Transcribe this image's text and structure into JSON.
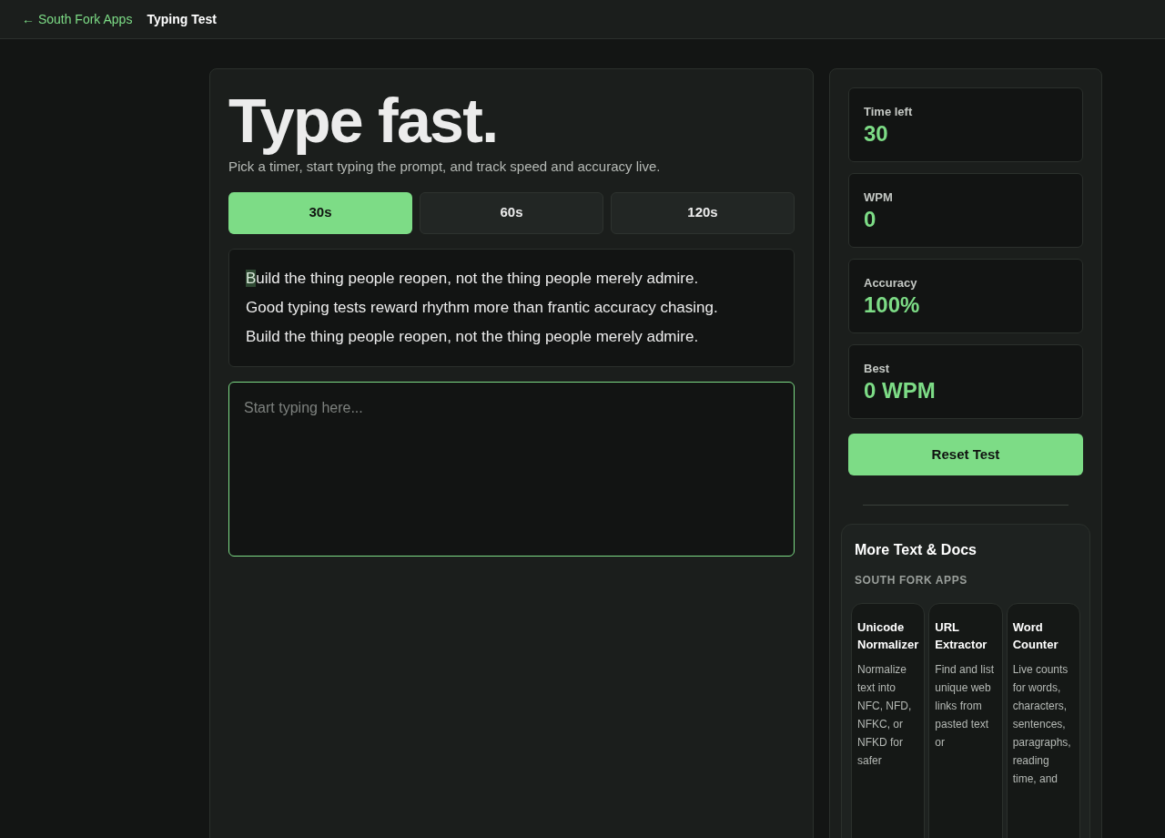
{
  "nav": {
    "back_link": "← South Fork Apps",
    "title": "Typing Test"
  },
  "hero": {
    "heading": "Type fast.",
    "subtitle": "Pick a timer, start typing the prompt, and track speed and accuracy live."
  },
  "timers": [
    {
      "label": "30s",
      "selected": true
    },
    {
      "label": "60s",
      "selected": false
    },
    {
      "label": "120s",
      "selected": false
    }
  ],
  "prompt": {
    "current_char": "B",
    "lines": [
      "uild the thing people reopen, not the thing people merely admire.",
      "Good typing tests reward rhythm more than frantic accuracy chasing.",
      "Build the thing people reopen, not the thing people merely admire."
    ]
  },
  "input": {
    "placeholder": "Start typing here..."
  },
  "stats": [
    {
      "label": "Time left",
      "value": "30"
    },
    {
      "label": "WPM",
      "value": "0"
    },
    {
      "label": "Accuracy",
      "value": "100%"
    },
    {
      "label": "Best",
      "value": "0 WPM"
    }
  ],
  "reset_button": "Reset Test",
  "related": {
    "title": "More Text & Docs",
    "subtitle": "SOUTH FORK APPS",
    "apps": [
      {
        "name": "Unicode Normalizer",
        "description": "Normalize text into NFC, NFD, NFKC, or NFKD for safer"
      },
      {
        "name": "URL Extractor",
        "description": "Find and list unique web links from pasted text or"
      },
      {
        "name": "Word Counter",
        "description": "Live counts for words, characters, sentences, paragraphs, reading time, and"
      }
    ]
  }
}
